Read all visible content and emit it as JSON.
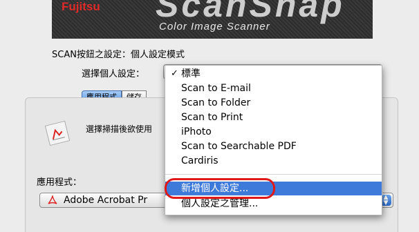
{
  "banner": {
    "brand": "Fujitsu",
    "logo_text": "ScanSnap",
    "tagline": "Color Image Scanner"
  },
  "mode_title": "SCAN按鈕之設定：個人設定模式",
  "profile_label": "選擇個人設定：",
  "tabs": [
    {
      "label": "應用程式",
      "active": true
    },
    {
      "label": "儲存",
      "active": false
    }
  ],
  "select_text": "選擇掃描後欲使用",
  "apps_label": "應用程式：",
  "app_select": {
    "value": "Adobe Acrobat Pr",
    "icon": "pdf-icon"
  },
  "menu": {
    "items": [
      {
        "label": "標準",
        "checked": true
      },
      {
        "label": "Scan to E-mail"
      },
      {
        "label": "Scan to Folder"
      },
      {
        "label": "Scan to Print"
      },
      {
        "label": "iPhoto"
      },
      {
        "label": "Scan to Searchable PDF"
      },
      {
        "label": "Cardiris"
      }
    ],
    "actions": [
      {
        "label": "新增個人設定...",
        "highlighted": true
      },
      {
        "label": "個人設定之管理..."
      }
    ]
  },
  "colors": {
    "highlight": "#3e7ad9",
    "annotation_ring": "#e01818",
    "brand_red": "#e02a2a"
  }
}
